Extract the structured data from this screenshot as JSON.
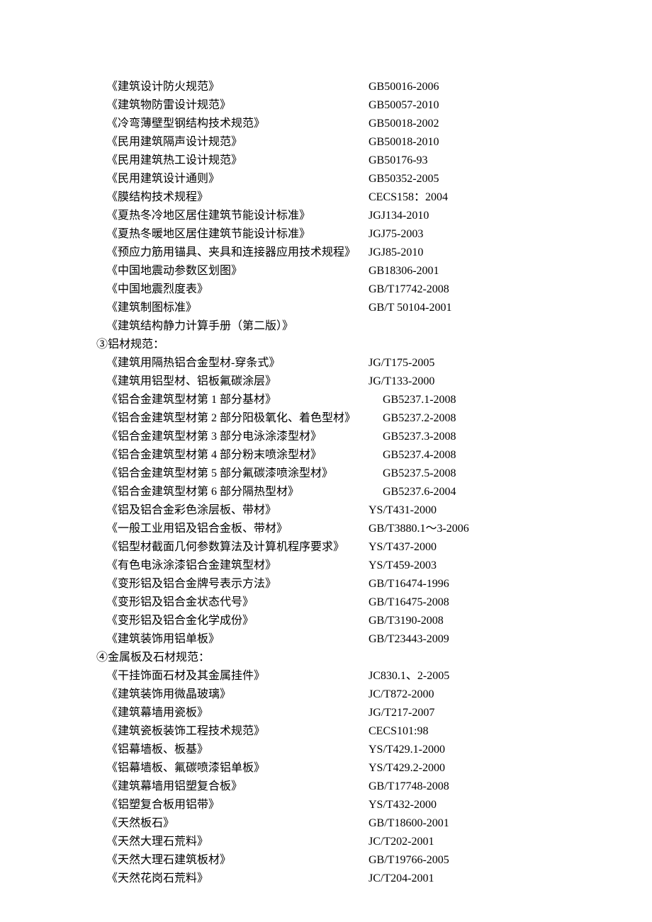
{
  "sections": [
    {
      "items": [
        {
          "name": "《建筑设计防火规范》",
          "code": "GB50016-2006"
        },
        {
          "name": "《建筑物防雷设计规范》",
          "code": "GB50057-2010"
        },
        {
          "name": "《冷弯薄壁型钢结构技术规范》",
          "code": "GB50018-2002"
        },
        {
          "name": "《民用建筑隔声设计规范》",
          "code": "GB50018-2010"
        },
        {
          "name": "《民用建筑热工设计规范》",
          "code": "GB50176-93"
        },
        {
          "name": "《民用建筑设计通则》",
          "code": "GB50352-2005"
        },
        {
          "name": "《膜结构技术规程》",
          "code": "CECS158：2004"
        },
        {
          "name": "《夏热冬冷地区居住建筑节能设计标准》",
          "code": "JGJ134-2010"
        },
        {
          "name": "《夏热冬暖地区居住建筑节能设计标准》",
          "code": "JGJ75-2003"
        },
        {
          "name": "《预应力筋用锚具、夹具和连接器应用技术规程》",
          "code": "JGJ85-2010"
        },
        {
          "name": "《中国地震动参数区划图》",
          "code": "GB18306-2001"
        },
        {
          "name": "《中国地震烈度表》",
          "code": "GB/T17742-2008"
        },
        {
          "name": "《建筑制图标准》",
          "code": "GB/T 50104-2001"
        },
        {
          "name": "《建筑结构静力计算手册（第二版）》",
          "code": ""
        }
      ]
    },
    {
      "heading": "③铝材规范：",
      "items": [
        {
          "name": "《建筑用隔热铝合金型材-穿条式》",
          "code": "JG/T175-2005"
        },
        {
          "name": "《建筑用铝型材、铝板氟碳涂层》",
          "code": "JG/T133-2000"
        },
        {
          "name": "《铝合金建筑型材第 1 部分基材》",
          "code": "GB5237.1-2008",
          "codeOffset": true
        },
        {
          "name": "《铝合金建筑型材第 2 部分阳极氧化、着色型材》",
          "code": "GB5237.2-2008",
          "codeOffset": true
        },
        {
          "name": "《铝合金建筑型材第 3 部分电泳涂漆型材》",
          "code": "GB5237.3-2008",
          "codeOffset": true
        },
        {
          "name": "《铝合金建筑型材第 4 部分粉末喷涂型材》",
          "code": "GB5237.4-2008",
          "codeOffset": true
        },
        {
          "name": "《铝合金建筑型材第 5 部分氟碳漆喷涂型材》",
          "code": "GB5237.5-2008",
          "codeOffset": true
        },
        {
          "name": "《铝合金建筑型材第 6 部分隔热型材》",
          "code": "GB5237.6-2004",
          "codeOffset": true
        },
        {
          "name": "《铝及铝合金彩色涂层板、带材》",
          "code": "YS/T431-2000"
        },
        {
          "name": "《一般工业用铝及铝合金板、带材》",
          "code": "GB/T3880.1～3-2006"
        },
        {
          "name": "《铝型材截面几何参数算法及计算机程序要求》",
          "code": "YS/T437-2000"
        },
        {
          "name": "《有色电泳涂漆铝合金建筑型材》",
          "code": "YS/T459-2003"
        },
        {
          "name": "《变形铝及铝合金牌号表示方法》",
          "code": "GB/T16474-1996"
        },
        {
          "name": "《变形铝及铝合金状态代号》",
          "code": "GB/T16475-2008"
        },
        {
          "name": "《变形铝及铝合金化学成份》",
          "code": "GB/T3190-2008"
        },
        {
          "name": "《建筑装饰用铝单板》",
          "code": "GB/T23443-2009"
        }
      ]
    },
    {
      "heading": "④金属板及石材规范：",
      "items": [
        {
          "name": "《干挂饰面石材及其金属挂件》",
          "code": "JC830.1、2-2005"
        },
        {
          "name": "《建筑装饰用微晶玻璃》",
          "code": "JC/T872-2000"
        },
        {
          "name": "《建筑幕墙用瓷板》",
          "code": "JG/T217-2007"
        },
        {
          "name": "《建筑瓷板装饰工程技术规范》",
          "code": "CECS101:98"
        },
        {
          "name": "《铝幕墙板、板基》",
          "code": "YS/T429.1-2000"
        },
        {
          "name": "《铝幕墙板、氟碳喷漆铝单板》",
          "code": "YS/T429.2-2000"
        },
        {
          "name": "《建筑幕墙用铝塑复合板》",
          "code": "GB/T17748-2008"
        },
        {
          "name": "《铝塑复合板用铝带》",
          "code": "YS/T432-2000"
        },
        {
          "name": "《天然板石》",
          "code": "GB/T18600-2001"
        },
        {
          "name": "《天然大理石荒料》",
          "code": "JC/T202-2001"
        },
        {
          "name": "《天然大理石建筑板材》",
          "code": "GB/T19766-2005"
        },
        {
          "name": "《天然花岗石荒料》",
          "code": "JC/T204-2001"
        }
      ]
    }
  ]
}
